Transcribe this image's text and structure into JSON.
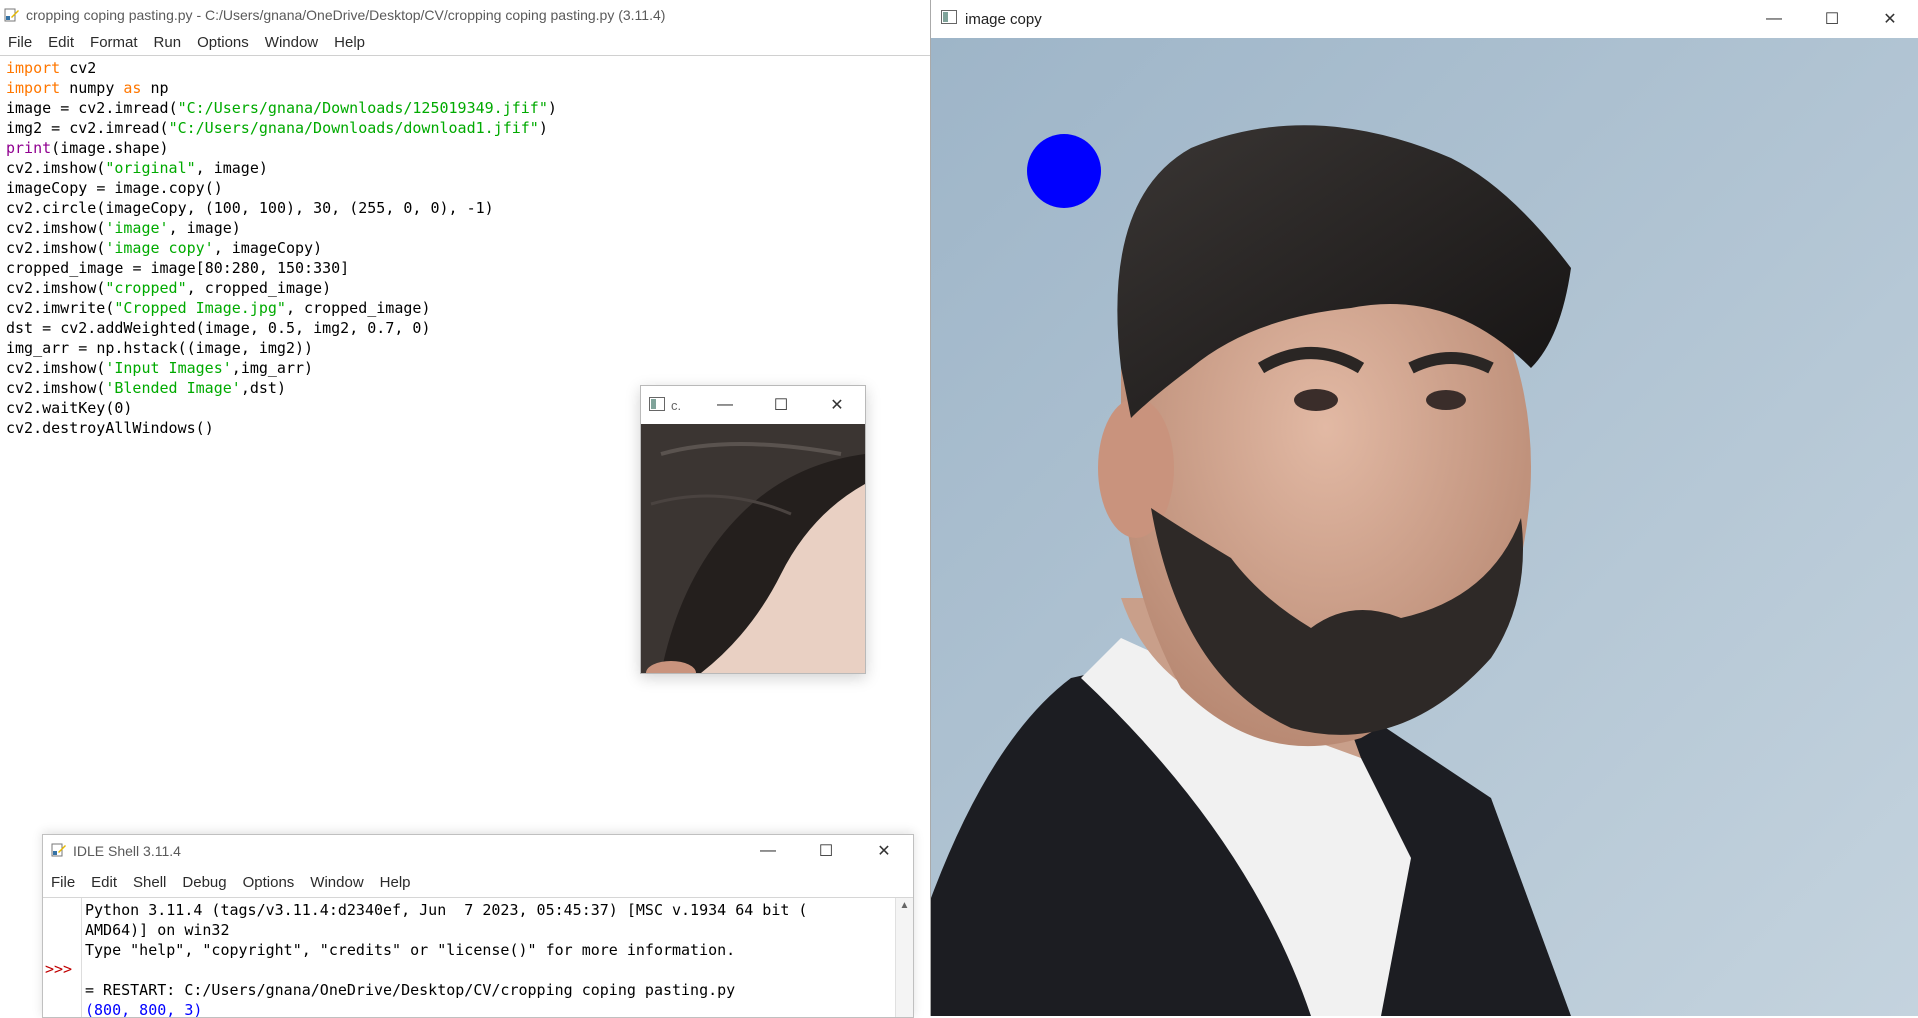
{
  "editor": {
    "title": "cropping coping pasting.py - C:/Users/gnana/OneDrive/Desktop/CV/cropping coping pasting.py (3.11.4)",
    "menu": [
      "File",
      "Edit",
      "Format",
      "Run",
      "Options",
      "Window",
      "Help"
    ],
    "code_lines": [
      "import cv2",
      "import numpy as np",
      "image = cv2.imread(\"C:/Users/gnana/Downloads/125019349.jfif\")",
      "img2 = cv2.imread(\"C:/Users/gnana/Downloads/download1.jfif\")",
      "print(image.shape)",
      "cv2.imshow(\"original\", image)",
      "imageCopy = image.copy()",
      "cv2.circle(imageCopy, (100, 100), 30, (255, 0, 0), -1)",
      "cv2.imshow('image', image)",
      "cv2.imshow('image copy', imageCopy)",
      "cropped_image = image[80:280, 150:330]",
      "cv2.imshow(\"cropped\", cropped_image)",
      "cv2.imwrite(\"Cropped Image.jpg\", cropped_image)",
      "dst = cv2.addWeighted(image, 0.5, img2, 0.7, 0)",
      "img_arr = np.hstack((image, img2))",
      "cv2.imshow('Input Images',img_arr)",
      "cv2.imshow('Blended Image',dst)",
      "cv2.waitKey(0)",
      "cv2.destroyAllWindows()"
    ]
  },
  "crop_window": {
    "title": "c."
  },
  "shell": {
    "title": "IDLE Shell 3.11.4",
    "menu": [
      "File",
      "Edit",
      "Shell",
      "Debug",
      "Options",
      "Window",
      "Help"
    ],
    "prompt": ">>>",
    "lines": [
      "Python 3.11.4 (tags/v3.11.4:d2340ef, Jun  7 2023, 05:45:37) [MSC v.1934 64 bit (",
      "AMD64)] on win32",
      "Type \"help\", \"copyright\", \"credits\" or \"license()\" for more information.",
      "",
      "= RESTART: C:/Users/gnana/OneDrive/Desktop/CV/cropping coping pasting.py",
      "(800, 800, 3)"
    ]
  },
  "image_window": {
    "title": "image copy",
    "circle_color": "#0000ff"
  },
  "colors": {
    "keyword": "#ff7700",
    "builtin": "#900090",
    "string": "#00aa00",
    "prompt": "#c00000",
    "output": "#0000ff"
  },
  "icons": [
    "python-idle-icon",
    "window-icon",
    "minimize-icon",
    "maximize-icon",
    "close-icon",
    "scroll-up-icon"
  ]
}
